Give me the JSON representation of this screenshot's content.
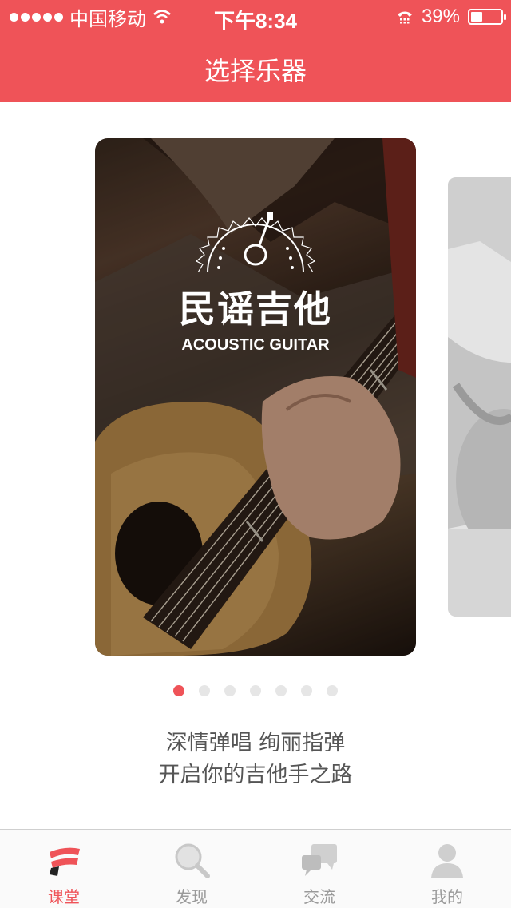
{
  "status_bar": {
    "carrier": "中国移动",
    "time": "下午8:34",
    "battery": "39%",
    "battery_level": 0.39,
    "icons": [
      "signal-dots-icon",
      "wifi-icon",
      "call-forward-icon",
      "battery-icon"
    ]
  },
  "nav": {
    "title": "选择乐器"
  },
  "carousel": {
    "cards": [
      {
        "title_cn": "民谣吉他",
        "title_en": "ACOUSTIC GUITAR"
      }
    ],
    "page_count": 7,
    "active_index": 0
  },
  "slogan": {
    "line1": "深情弹唱 绚丽指弹",
    "line2": "开启你的吉他手之路"
  },
  "tabbar": {
    "items": [
      {
        "label": "课堂",
        "icon": "classroom-icon",
        "active": true
      },
      {
        "label": "发现",
        "icon": "search-icon",
        "active": false
      },
      {
        "label": "交流",
        "icon": "chat-icon",
        "active": false
      },
      {
        "label": "我的",
        "icon": "profile-icon",
        "active": false
      }
    ]
  },
  "colors": {
    "accent": "#ef5358",
    "inactive": "#9a9a9a"
  }
}
